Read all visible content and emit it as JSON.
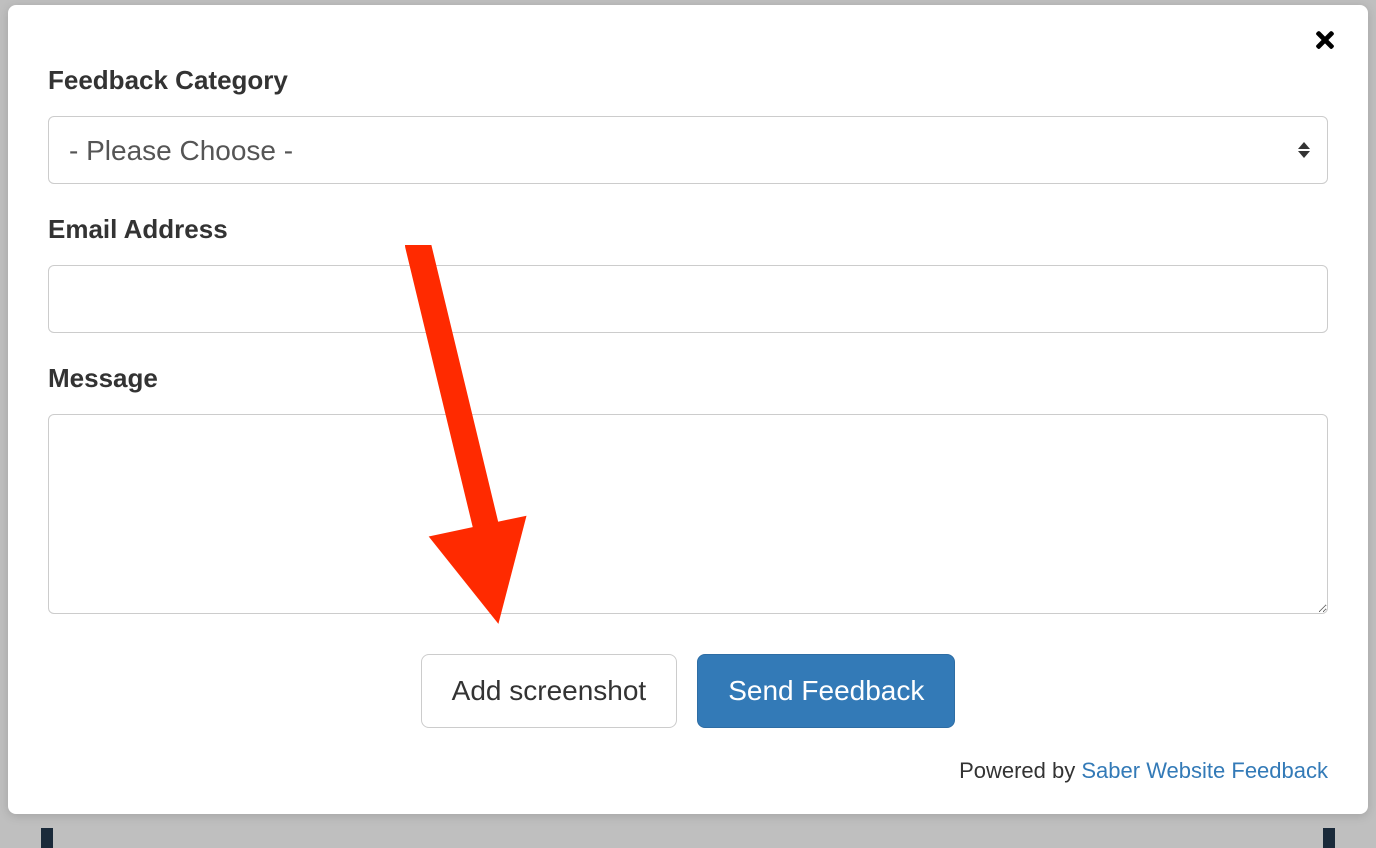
{
  "form": {
    "category": {
      "label": "Feedback Category",
      "selected": "- Please Choose -"
    },
    "email": {
      "label": "Email Address",
      "value": ""
    },
    "message": {
      "label": "Message",
      "value": ""
    }
  },
  "buttons": {
    "add_screenshot": "Add screenshot",
    "send_feedback": "Send Feedback"
  },
  "footer": {
    "prefix": "Powered by ",
    "link_text": "Saber Website Feedback"
  }
}
